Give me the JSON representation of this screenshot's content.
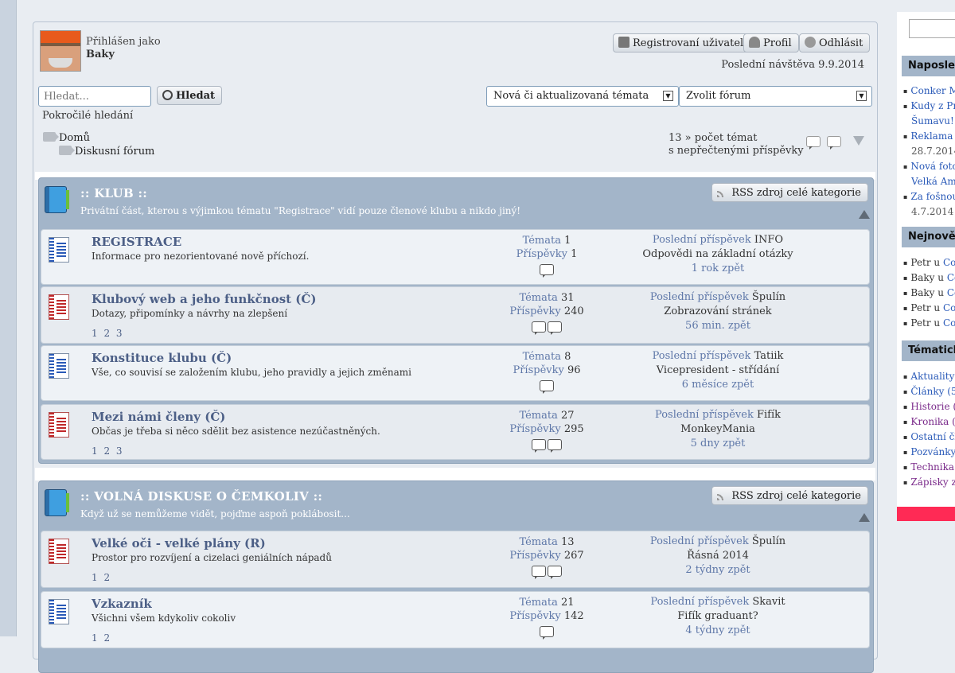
{
  "user": {
    "logged_label": "Přihlášen jako",
    "name": "Baky"
  },
  "header_buttons": {
    "registered": "Registrovaní uživatelé",
    "profile": "Profil",
    "logout": "Odhlásit"
  },
  "last_visit": "Poslední návštěva 9.9.2014",
  "search": {
    "placeholder": "Hledat...",
    "button": "Hledat",
    "advanced": "Pokročilé hledání"
  },
  "selects": {
    "topics": "Nová či aktualizovaná témata",
    "forum": "Zvolit fórum"
  },
  "breadcrumb": {
    "home": "Domů",
    "forum": "Diskusní fórum"
  },
  "unread": {
    "line1": "13 » počet témat",
    "line2": "s nepřečtenými příspěvky"
  },
  "labels": {
    "topics": "Témata",
    "posts": "Příspěvky",
    "last_post": "Poslední příspěvek",
    "rss": "RSS zdroj celé kategorie"
  },
  "categories": [
    {
      "title": ":: KLUB ::",
      "desc": "Privátní část, kterou s výjimkou tématu \"Registrace\" vidí pouze členové klubu a nikdo jiný!",
      "forums": [
        {
          "title": "REGISTRACE",
          "desc": "Informace pro nezorientované nově příchozí.",
          "pages": "",
          "topics": "1",
          "posts": "1",
          "last_author": "INFO",
          "last_subject": "Odpovědi na základní otázky",
          "last_when": "1 rok zpět",
          "icon": "blue"
        },
        {
          "title": "Klubový web a jeho funkčnost (Č)",
          "desc": "Dotazy, připomínky a návrhy na zlepšení",
          "pages": "1 2 3",
          "topics": "31",
          "posts": "240",
          "last_author": "Špulín",
          "last_subject": "Zobrazování stránek",
          "last_when": "56 min. zpět",
          "icon": "red"
        },
        {
          "title": "Konstituce klubu (Č)",
          "desc": "Vše, co souvisí se založením klubu, jeho pravidly a jejich změnami",
          "pages": "",
          "topics": "8",
          "posts": "96",
          "last_author": "Tatiik",
          "last_subject": "Vicepresident - střídání",
          "last_when": "6 měsíce zpět",
          "icon": "blue"
        },
        {
          "title": "Mezi námi členy (Č)",
          "desc": "Občas je třeba si něco sdělit bez asistence nezúčastněných.",
          "pages": "1 2 3",
          "topics": "27",
          "posts": "295",
          "last_author": "Fifík",
          "last_subject": "MonkeyMania",
          "last_when": "5 dny zpět",
          "icon": "red"
        }
      ]
    },
    {
      "title": ":: VOLNÁ DISKUSE O ČEMKOLIV ::",
      "desc": "Když už se nemůžeme vidět, pojďme aspoň poklábosit...",
      "forums": [
        {
          "title": "Velké oči - velké plány (R)",
          "desc": "Prostor pro rozvíjení a cizelaci geniálních nápadů",
          "pages": "1 2",
          "topics": "13",
          "posts": "267",
          "last_author": "Špulín",
          "last_subject": "Řásná 2014",
          "last_when": "2 týdny zpět",
          "icon": "red"
        },
        {
          "title": "Vzkazník",
          "desc": "Všichni všem kdykoliv cokoliv",
          "pages": "1 2",
          "topics": "21",
          "posts": "142",
          "last_author": "Skavit",
          "last_subject": "Fifík graduant?",
          "last_when": "4 týdny zpět",
          "icon": "blue"
        }
      ]
    }
  ],
  "sidebar": {
    "head1": "Naposled",
    "list1": [
      {
        "text": "Conker M",
        "kind": "link"
      },
      {
        "text": "Kudy z Pra",
        "kind": "link"
      },
      {
        "text": "Šumavu! :",
        "kind": "link",
        "nb": true
      },
      {
        "text": "Reklama n",
        "kind": "link"
      },
      {
        "text": "28.7.2014",
        "kind": "date",
        "nb": true
      },
      {
        "text": "Nová foto",
        "kind": "link"
      },
      {
        "text": "Velká Ame",
        "kind": "link",
        "nb": true
      },
      {
        "text": "Za fošnou",
        "kind": "link"
      },
      {
        "text": "4.7.2014",
        "kind": "date",
        "nb": true
      }
    ],
    "head2": "Nejnověj",
    "list2": [
      {
        "prefix": "Petr u ",
        "text": "Con"
      },
      {
        "prefix": "Baky u ",
        "text": "Co"
      },
      {
        "prefix": "Baky u ",
        "text": "Co"
      },
      {
        "prefix": "Petr u ",
        "text": "Con"
      },
      {
        "prefix": "Petr u ",
        "text": "Con"
      }
    ],
    "head3": "Tématick",
    "list3": [
      {
        "text": "Aktuality (",
        "kind": "link"
      },
      {
        "text": "Články (5",
        "kind": "link"
      },
      {
        "text": "Historie (:",
        "kind": "vlink"
      },
      {
        "text": "Kronika (6",
        "kind": "vlink"
      },
      {
        "text": "Ostatní čla",
        "kind": "link"
      },
      {
        "text": "Pozvánky",
        "kind": "link"
      },
      {
        "text": "Technika (",
        "kind": "vlink"
      },
      {
        "text": "Zápisky z",
        "kind": "vlink"
      }
    ]
  }
}
